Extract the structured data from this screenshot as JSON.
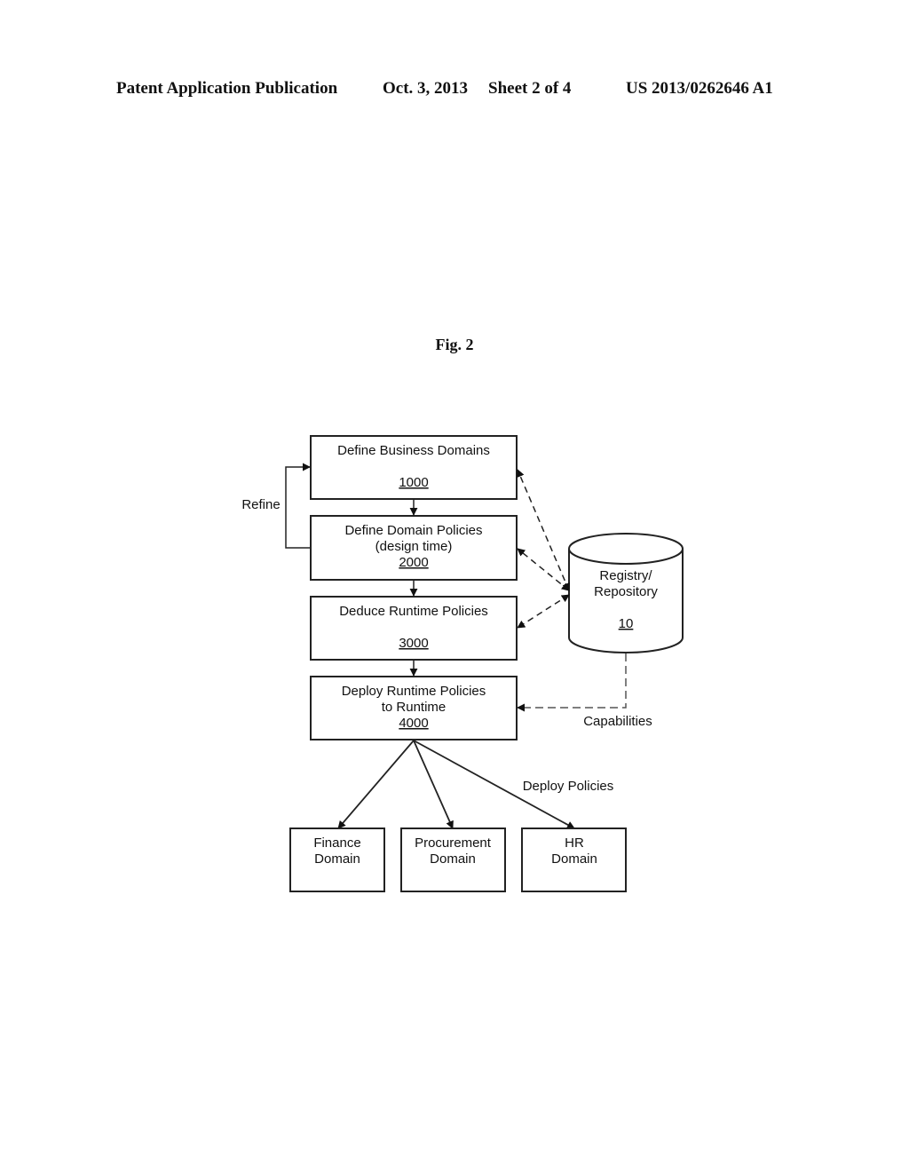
{
  "header": {
    "publication": "Patent Application Publication",
    "date": "Oct. 3, 2013",
    "sheet": "Sheet 2 of 4",
    "patent_number": "US 2013/0262646 A1"
  },
  "figure": {
    "label": "Fig. 2"
  },
  "steps": [
    {
      "lines": [
        "Define Business Domains",
        ""
      ],
      "ref": "1000"
    },
    {
      "lines": [
        "Define Domain Policies",
        "(design time)"
      ],
      "ref": "2000"
    },
    {
      "lines": [
        "Deduce Runtime Policies",
        ""
      ],
      "ref": "3000"
    },
    {
      "lines": [
        "Deploy Runtime Policies",
        "to Runtime"
      ],
      "ref": "4000"
    }
  ],
  "registry": {
    "lines": [
      "Registry/",
      "Repository"
    ],
    "ref": "10"
  },
  "labels": {
    "refine": "Refine",
    "capabilities": "Capabilities",
    "deploy_policies": "Deploy Policies"
  },
  "domains": [
    {
      "lines": [
        "Finance",
        "Domain"
      ]
    },
    {
      "lines": [
        "Procurement",
        "Domain"
      ]
    },
    {
      "lines": [
        "HR",
        "Domain"
      ]
    }
  ]
}
